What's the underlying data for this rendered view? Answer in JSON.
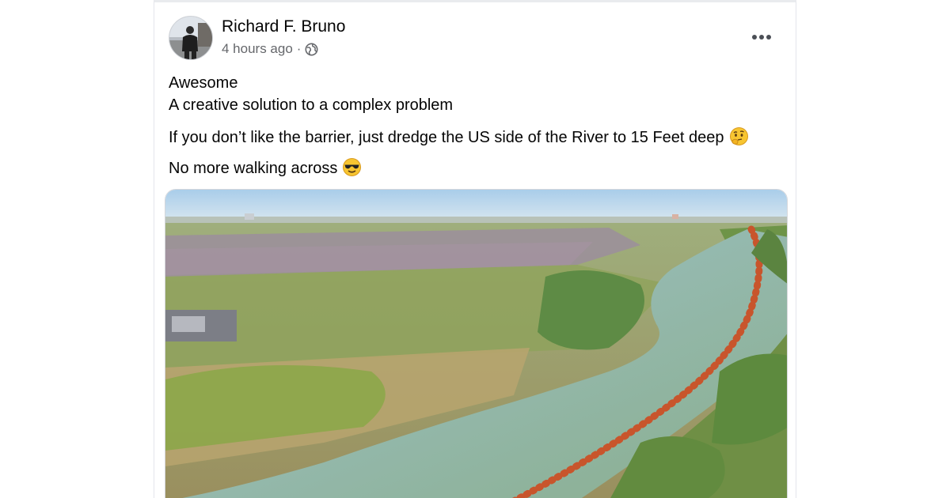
{
  "post": {
    "author_name": "Richard F. Bruno",
    "timestamp": "4 hours ago",
    "separator": "·",
    "privacy_icon": "globe-icon",
    "more_icon": "more-options-icon",
    "lines": [
      "Awesome",
      "A creative solution to a complex problem",
      "If you don’t like the barrier, just dredge the US side of the River to 15 Feet deep",
      "No more walking across"
    ],
    "line3_emoji": "thinking-face-emoji",
    "line4_emoji": "sunglasses-face-emoji"
  },
  "colors": {
    "name_text": "#050505",
    "meta_text": "#65676b",
    "card_border": "#e4e6eb",
    "river": "#8fb7a8",
    "buoys": "#c8552c",
    "sky": "#b9d6ee"
  }
}
